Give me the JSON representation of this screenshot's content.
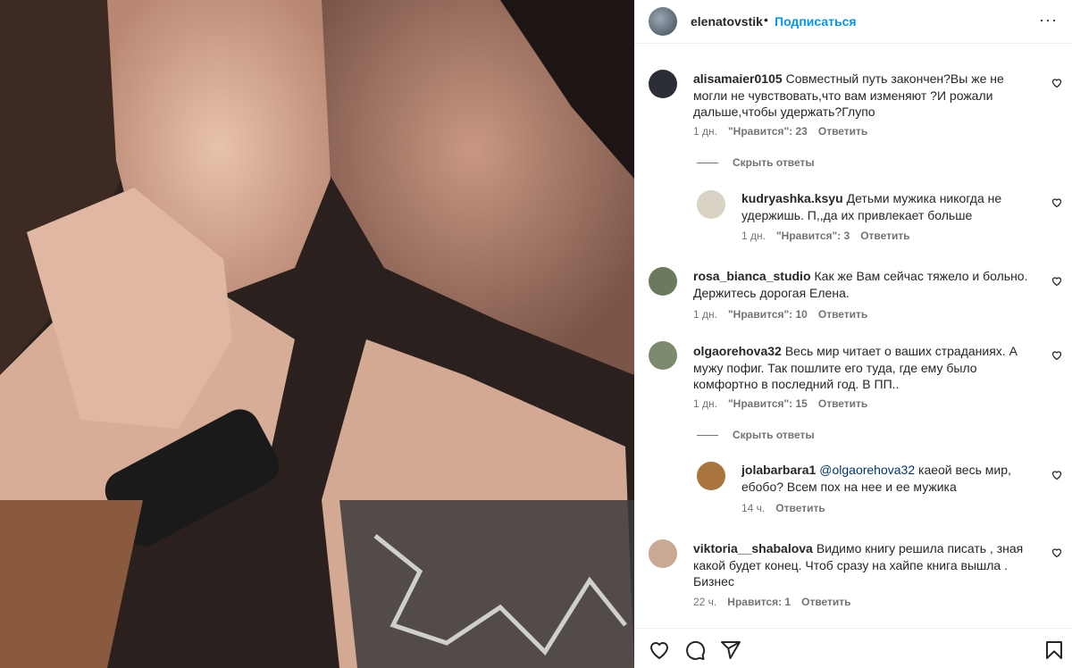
{
  "header": {
    "username": "elenatovstik",
    "separator": "•",
    "follow_label": "Подписаться",
    "more_label": "···"
  },
  "comments": [
    {
      "user": "alisamaier0105",
      "text": "Совместный путь закончен?Вы же не могли не чувствовать,что вам изменяют ?И рожали дальше,чтобы удержать?Глупо",
      "age": "1 дн.",
      "likes": "\"Нравится\": 23",
      "reply_label": "Ответить",
      "avatar_color": "#2b2f35",
      "toggle_label": "Скрыть ответы",
      "replies": [
        {
          "user": "kudryashka.ksyu",
          "text": "Детьми мужика никогда не удержишь. П,,да их привлекает больше",
          "age": "1 дн.",
          "likes": "\"Нравится\": 3",
          "reply_label": "Ответить",
          "avatar_color": "#d9d3c6"
        }
      ]
    },
    {
      "user": "rosa_bianca_studio",
      "text": "Как же Вам сейчас тяжело и больно. Держитесь дорогая Елена.",
      "age": "1 дн.",
      "likes": "\"Нравится\": 10",
      "reply_label": "Ответить",
      "avatar_color": "#6b7a5c"
    },
    {
      "user": "olgaorehova32",
      "text": "Весь мир читает о ваших страданиях. А мужу пофиг. Так пошлите его туда, где ему было комфортно в последний год. В ПП..",
      "age": "1 дн.",
      "likes": "\"Нравится\": 15",
      "reply_label": "Ответить",
      "avatar_color": "#7d8a6e",
      "toggle_label": "Скрыть ответы",
      "replies": [
        {
          "user": "jolabarbara1",
          "mention": "@olgaorehova32",
          "text": "каеой весь мир, ебобо? Всем пох на нее и ее мужика",
          "age": "14 ч.",
          "reply_label": "Ответить",
          "avatar_color": "#a9743d"
        }
      ]
    },
    {
      "user": "viktoria__shabalova",
      "text": "Видимо книгу решила писать , зная какой будет конец. Чтоб сразу на хайпе книга вышла . Бизнес",
      "age": "22 ч.",
      "likes": "Нравится: 1",
      "reply_label": "Ответить",
      "avatar_color": "#c9a894"
    }
  ],
  "icons": {
    "like": "heart-icon",
    "comment": "comment-icon",
    "share": "send-icon",
    "save": "bookmark-icon"
  }
}
